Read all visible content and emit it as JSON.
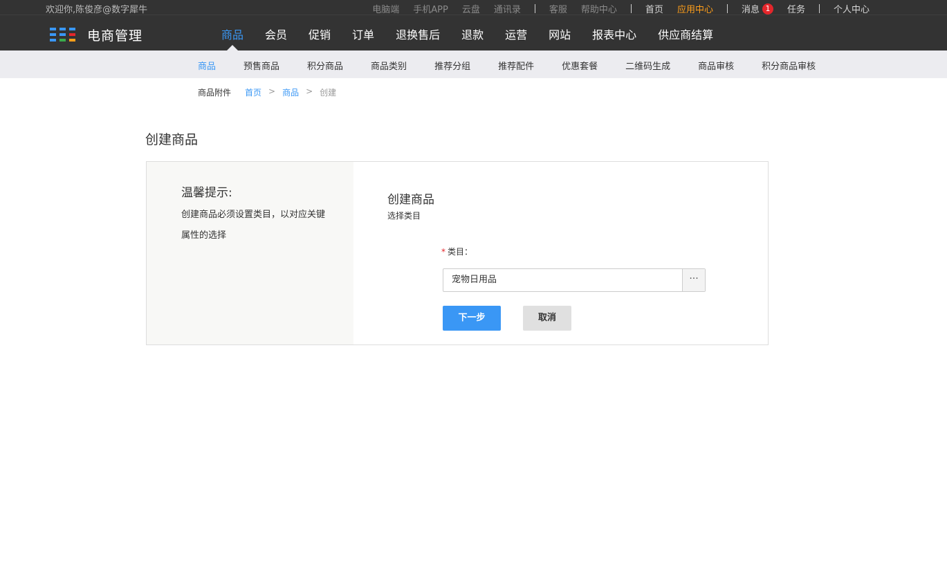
{
  "header": {
    "welcome": "欢迎你,陈俊彦@数字犀牛",
    "links_gray": [
      "电脑端",
      "手机APP",
      "云盘",
      "通讯录"
    ],
    "links_gray2": [
      "客服",
      "帮助中心"
    ],
    "home": "首页",
    "app_center": "应用中心",
    "messages": "消息",
    "message_count": "1",
    "tasks": "任务",
    "profile": "个人中心",
    "brand": "电商管理",
    "brand_colors": [
      "#3a97f5",
      "#3a97f5",
      "#3a97f5",
      "#3a97f5",
      "#3a97f5",
      "#e4262b",
      "#3a97f5",
      "#3aab4c",
      "#ff9f1a"
    ]
  },
  "main_nav": [
    "商品",
    "会员",
    "促销",
    "订单",
    "退换售后",
    "退款",
    "运营",
    "网站",
    "报表中心",
    "供应商结算"
  ],
  "sub_nav": [
    "商品",
    "预售商品",
    "积分商品",
    "商品类别",
    "推荐分组",
    "推荐配件",
    "优惠套餐",
    "二维码生成",
    "商品审核",
    "积分商品审核"
  ],
  "breadcrumb": {
    "section": "商品附件",
    "home": "首页",
    "goods": "商品",
    "current": "创建",
    "separator": ">"
  },
  "page": {
    "title": "创建商品"
  },
  "tips": {
    "title": "温馨提示:",
    "text": "创建商品必须设置类目，以对应关键属性的选择"
  },
  "form": {
    "title": "创建商品",
    "subtitle": "选择类目",
    "required_mark": "*",
    "category_label": "类目：",
    "category_value": "宠物日用品",
    "picker_label": "···",
    "next_label": "下一步",
    "cancel_label": "取消"
  },
  "colors": {
    "accent": "#3a97f5",
    "header_bg": "#333333",
    "orange": "#ff9f1a",
    "badge": "#e4262b"
  }
}
